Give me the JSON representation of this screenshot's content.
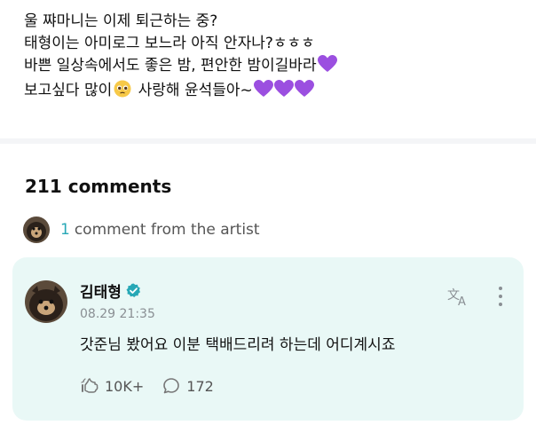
{
  "post": {
    "lines": [
      "울 쨔마니는 이제 퇴근하는 중?",
      "태형이는 아미로그 보느라 아직 안자나?ㅎㅎㅎ",
      "바쁜 일상속에서도 좋은 밤, 편안한 밤이길바라",
      "보고싶다 많이",
      "사랑해 윤석들아~"
    ],
    "heart_color": "#9b4fe0"
  },
  "comments": {
    "count_label": "211 comments",
    "artist_count": "1",
    "artist_label": "comment from the artist"
  },
  "comment": {
    "author": "김태형",
    "timestamp": "08.29 21:35",
    "body": "갓준님 봤어요 이분 택배드리려 하는데 어디계시죠",
    "likes": "10K+",
    "replies": "172",
    "card_color": "#e9f8f6",
    "accent": "#27a8b6"
  }
}
